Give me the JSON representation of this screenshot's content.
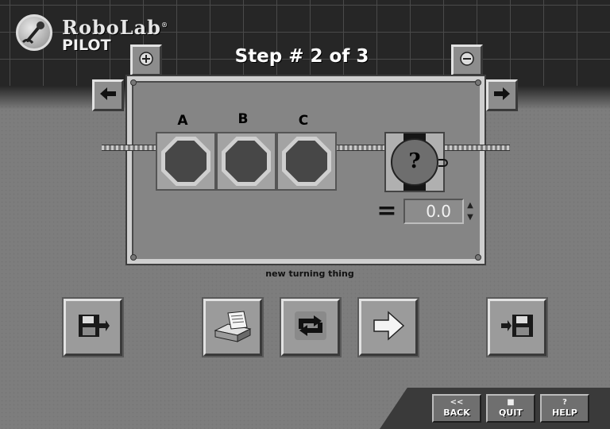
{
  "brand": {
    "name": "RoboLab",
    "tm": "®",
    "product": "PILOT"
  },
  "step": {
    "title": "Step # 2 of 3"
  },
  "toolbar": {
    "zoom_in_icon": "plus-circle-icon",
    "zoom_out_icon": "minus-circle-icon",
    "prev_icon": "arrow-left-icon",
    "next_icon": "arrow-right-icon"
  },
  "program": {
    "slots": [
      {
        "label": "A",
        "icon": "octagon-icon"
      },
      {
        "label": "B",
        "icon": "octagon-icon"
      },
      {
        "label": "C",
        "icon": "octagon-icon"
      }
    ],
    "timer": {
      "symbol": "?",
      "icon": "timer-dial-icon"
    },
    "equals": "=",
    "value": "0.0",
    "spin_up": "▲",
    "spin_down": "▼"
  },
  "status_text": "new turning thing",
  "actions": [
    {
      "name": "save-to-rcx",
      "icon": "floppy-export-icon"
    },
    {
      "name": "print",
      "icon": "printer-icon"
    },
    {
      "name": "loop",
      "icon": "loop-arrows-icon"
    },
    {
      "name": "run",
      "icon": "arrow-right-icon"
    },
    {
      "name": "load-from-rcx",
      "icon": "floppy-import-icon"
    }
  ],
  "nav": {
    "back": {
      "glyph": "<<",
      "label": "BACK"
    },
    "quit": {
      "glyph": "■",
      "label": "QUIT"
    },
    "help": {
      "glyph": "?",
      "label": "HELP"
    }
  }
}
